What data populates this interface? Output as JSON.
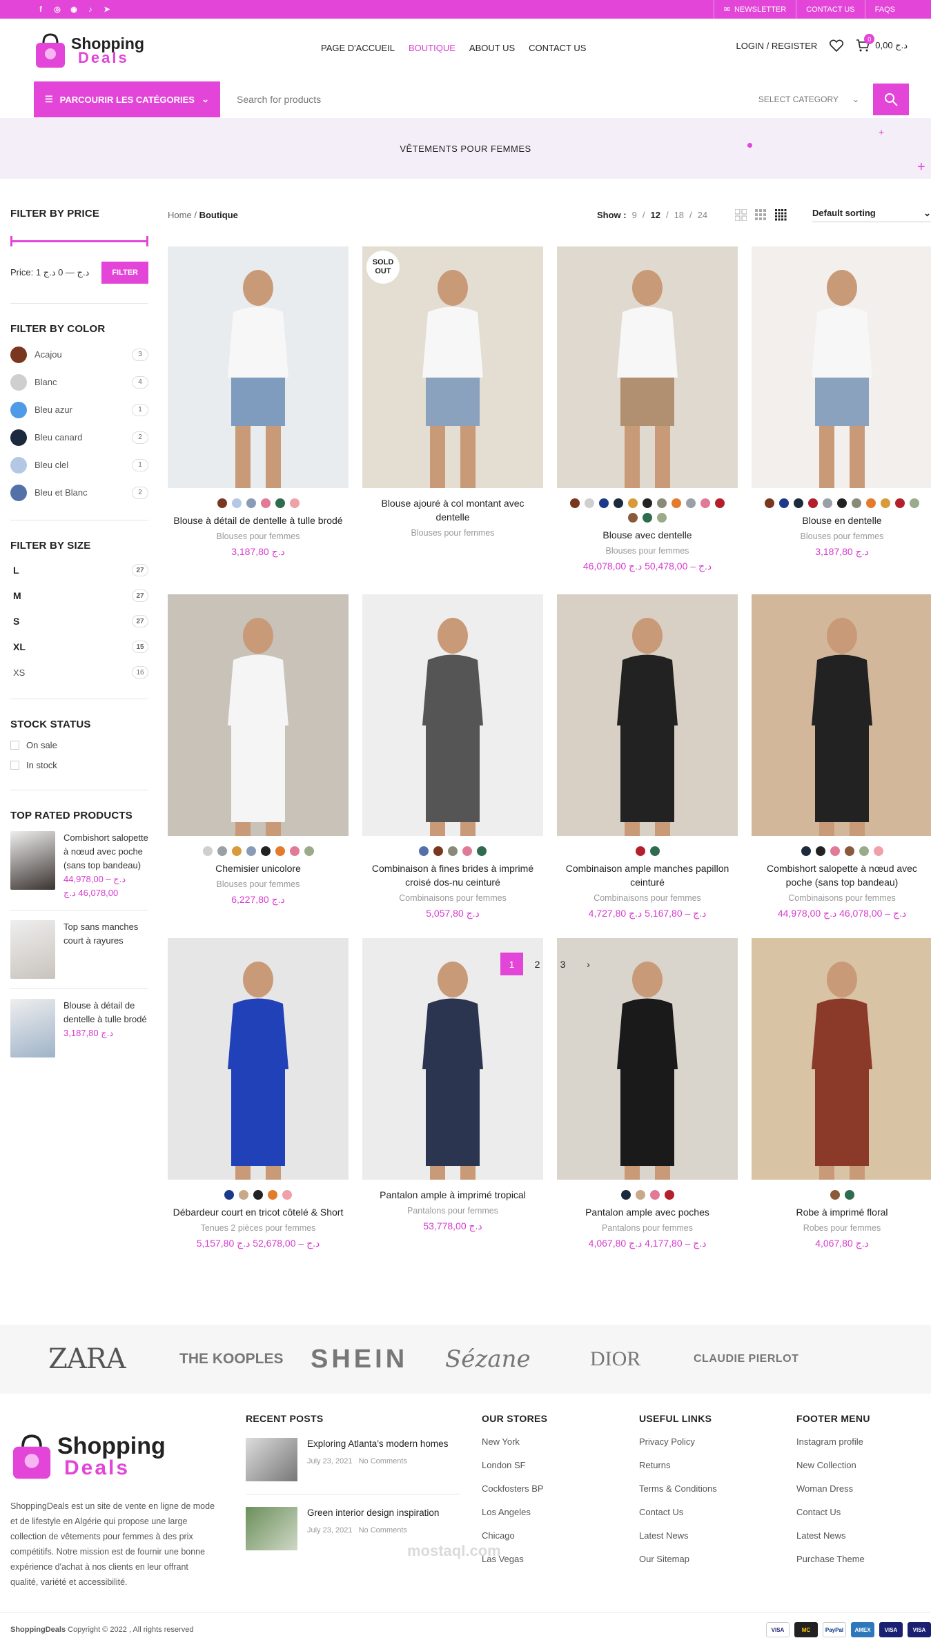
{
  "topbar": {
    "social": [
      "facebook-icon",
      "instagram-icon",
      "whatsapp-icon",
      "tiktok-icon",
      "telegram-icon"
    ],
    "links": [
      "NEWSLETTER",
      "CONTACT US",
      "FAQS"
    ]
  },
  "header": {
    "logo_line1": "Shopping",
    "logo_line2": "Deals",
    "nav": [
      "PAGE D'ACCUEIL",
      "BOUTIQUE",
      "ABOUT US",
      "CONTACT US"
    ],
    "active_nav": "BOUTIQUE",
    "login": "LOGIN / REGISTER",
    "cart_count": "0",
    "cart_total": "0,00 د.ج"
  },
  "search": {
    "categories_button": "PARCOURIR LES CATÉGORIES",
    "placeholder": "Search for products",
    "select_category": "SELECT CATEGORY"
  },
  "banner": {
    "title": "VÊTEMENTS POUR FEMMES"
  },
  "sidebar": {
    "price_title": "FILTER BY PRICE",
    "price_text": "Price: 1 د.ج — 0 د.ج",
    "filter_button": "FILTER",
    "color_title": "FILTER BY COLOR",
    "colors": [
      {
        "name": "Acajou",
        "count": "3",
        "hex": "#7a3720"
      },
      {
        "name": "Blanc",
        "count": "4",
        "hex": "#cfcfcf"
      },
      {
        "name": "Bleu azur",
        "count": "1",
        "hex": "#4f9be8"
      },
      {
        "name": "Bleu canard",
        "count": "2",
        "hex": "#1c2a3d"
      },
      {
        "name": "Bleu clel",
        "count": "1",
        "hex": "#b4c8e6"
      },
      {
        "name": "Bleu et Blanc",
        "count": "2",
        "hex": "#5470a8"
      }
    ],
    "size_title": "FILTER BY SIZE",
    "sizes": [
      {
        "name": "L",
        "count": "27"
      },
      {
        "name": "M",
        "count": "27"
      },
      {
        "name": "S",
        "count": "27"
      },
      {
        "name": "XL",
        "count": "15"
      },
      {
        "name": "XS",
        "count": "16"
      }
    ],
    "stock_title": "STOCK STATUS",
    "stock": [
      "On sale",
      "In stock"
    ],
    "top_title": "TOP RATED PRODUCTS",
    "top": [
      {
        "name": "Combishort salopette à nœud avec poche (sans top bandeau)",
        "price": "44,978,00 د.ج – 46,078,00 د.ج",
        "color": "#3a3330"
      },
      {
        "name": "Top sans manches court à rayures",
        "price": "",
        "color": "#c9c3bd"
      },
      {
        "name": "Blouse à détail de dentelle à tulle brodé",
        "price": "3,187,80 د.ج",
        "color": "#9fb3c9"
      }
    ]
  },
  "toolbar": {
    "crumb_home": "Home",
    "crumb_sep": "/",
    "crumb_current": "Boutique",
    "show_label": "Show :",
    "show_options": [
      "9",
      "12",
      "18",
      "24"
    ],
    "sorting": "Default sorting"
  },
  "products": [
    {
      "name": "Blouse à détail de dentelle à tulle brodé",
      "category": "Blouses pour femmes",
      "price": "3,187,80 د.ج",
      "swatches": [
        "#7a3720",
        "#b4c8e6",
        "#8a9bb5",
        "#e07a96",
        "#2f6b4f",
        "#f0a0a8"
      ],
      "img": [
        "#e9ecef",
        "#7f9bbd"
      ],
      "sold": ""
    },
    {
      "name": "Blouse ajouré à col montant avec dentelle",
      "category": "Blouses pour femmes",
      "price": "",
      "swatches": [],
      "img": [
        "#e3ddd2",
        "#8aa2bd"
      ],
      "sold": "SOLD OUT"
    },
    {
      "name": "Blouse avec dentelle",
      "category": "Blouses pour femmes",
      "price": "46,078,00 د.ج – 50,478,00 د.ج",
      "swatches": [
        "#7a3720",
        "#cfcfcf",
        "#1d3a8a",
        "#1c2a3d",
        "#d99a3a",
        "#222222",
        "#8a8a7a",
        "#e37b2b",
        "#9aa0a8",
        "#e07a96",
        "#b31f2a",
        "#8b5a3c",
        "#2f6b4f",
        "#9aab8a"
      ],
      "img": [
        "#e0d9cf",
        "#b09070"
      ],
      "sold": ""
    },
    {
      "name": "Blouse en dentelle",
      "category": "Blouses pour femmes",
      "price": "3,187,80 د.ج",
      "swatches": [
        "#7a3720",
        "#1d3a8a",
        "#1c2a3d",
        "#b31f2a",
        "#9aa0a8",
        "#222222",
        "#8a8a7a",
        "#e37b2b",
        "#d99a3a",
        "#b31f2a",
        "#9aab8a"
      ],
      "img": [
        "#f2efec",
        "#8aa2bd"
      ],
      "sold": ""
    },
    {
      "name": "Chemisier unicolore",
      "category": "Blouses pour femmes",
      "price": "6,227,80 د.ج",
      "swatches": [
        "#cfcfcf",
        "#9aa0a8",
        "#d99a3a",
        "#8a9bb5",
        "#222222",
        "#e37b2b",
        "#e07a96",
        "#9aab8a"
      ],
      "img": [
        "#c8c2b8",
        "#f5f5f5"
      ],
      "sold": ""
    },
    {
      "name": "Combinaison à fines brides à imprimé croisé dos-nu ceinturé",
      "category": "Combinaisons pour femmes",
      "price": "5,057,80 د.ج",
      "swatches": [
        "#5470a8",
        "#7a3720",
        "#8a8a7a",
        "#e07a96",
        "#2f6b4f"
      ],
      "img": [
        "#eeeeee",
        "#555555"
      ],
      "sold": ""
    },
    {
      "name": "Combinaison ample manches papillon ceinturé",
      "category": "Combinaisons pour femmes",
      "price": "4,727,80 د.ج – 5,167,80 د.ج",
      "swatches": [
        "#b31f2a",
        "#2f6b4f"
      ],
      "img": [
        "#d8d0c4",
        "#222222"
      ],
      "sold": ""
    },
    {
      "name": "Combishort salopette à nœud avec poche (sans top bandeau)",
      "category": "Combinaisons pour femmes",
      "price": "44,978,00 د.ج – 46,078,00 د.ج",
      "swatches": [
        "#1c2a3d",
        "#222222",
        "#e07a96",
        "#8b5a3c",
        "#9aab8a",
        "#f0a0a8"
      ],
      "img": [
        "#d3b79a",
        "#222222"
      ],
      "sold": ""
    },
    {
      "name": "Débardeur court en tricot côtelé & Short",
      "category": "Tenues 2 pièces pour femmes",
      "price": "5,157,80 د.ج – 52,678,00 د.ج",
      "swatches": [
        "#1d3a8a",
        "#c8a98a",
        "#222222",
        "#e37b2b",
        "#f0a0a8"
      ],
      "img": [
        "#e6e6e6",
        "#2141b8"
      ],
      "sold": ""
    },
    {
      "name": "Pantalon ample à imprimé tropical",
      "category": "Pantalons pour femmes",
      "price": "53,778,00 د.ج",
      "swatches": [],
      "img": [
        "#ececec",
        "#2b3550"
      ],
      "sold": ""
    },
    {
      "name": "Pantalon ample avec poches",
      "category": "Pantalons pour femmes",
      "price": "4,067,80 د.ج – 4,177,80 د.ج",
      "swatches": [
        "#1c2a3d",
        "#c8a98a",
        "#e07a96",
        "#b31f2a"
      ],
      "img": [
        "#d9d4cc",
        "#1a1a1a"
      ],
      "sold": ""
    },
    {
      "name": "Robe à imprimé floral",
      "category": "Robes pour femmes",
      "price": "4,067,80 د.ج",
      "swatches": [
        "#8a5a3a",
        "#2f6b4f"
      ],
      "img": [
        "#d9c3a5",
        "#8b3a2a"
      ],
      "sold": ""
    }
  ],
  "pagination": [
    "1",
    "2",
    "3",
    "›"
  ],
  "brands": [
    "ZARA",
    "THE KOOPLES",
    "SHEIN",
    "Sézane",
    "DIOR",
    "CLAUDIE PIERLOT"
  ],
  "footer": {
    "about": "ShoppingDeals est un site de vente en ligne de mode et de lifestyle en Algérie qui propose une large collection de vêtements pour femmes à des prix compétitifs. Notre mission est de fournir une bonne expérience d'achat à nos clients en leur offrant qualité, variété et accessibilité.",
    "recent_title": "RECENT POSTS",
    "posts": [
      {
        "title": "Exploring Atlanta's modern homes",
        "date": "July 23, 2021",
        "comments": "No Comments"
      },
      {
        "title": "Green interior design inspiration",
        "date": "July 23, 2021",
        "comments": "No Comments"
      }
    ],
    "stores_title": "OUR STORES",
    "stores": [
      "New York",
      "London SF",
      "Cockfosters BP",
      "Los Angeles",
      "Chicago",
      "Las Vegas"
    ],
    "useful_title": "USEFUL LINKS",
    "useful": [
      "Privacy Policy",
      "Returns",
      "Terms & Conditions",
      "Contact Us",
      "Latest News",
      "Our Sitemap"
    ],
    "menu_title": "FOOTER MENU",
    "menu": [
      "Instagram profile",
      "New Collection",
      "Woman Dress",
      "Contact Us",
      "Latest News",
      "Purchase Theme"
    ],
    "copyright_brand": "ShoppingDeals",
    "copyright_text": "Copyright © 2022 , All rights reserved",
    "payments": [
      "VISA",
      "MC",
      "PayPal",
      "AMEX",
      "VISA",
      "VISA"
    ]
  },
  "watermark": "mostaql.com"
}
